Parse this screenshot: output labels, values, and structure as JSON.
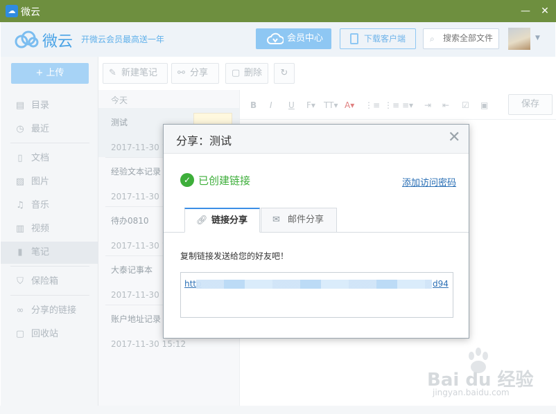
{
  "titlebar": {
    "title": "微云",
    "min_glyph": "—",
    "close_glyph": "✕"
  },
  "header": {
    "logo_text": "微云",
    "promo": "开微云会员最高送一年",
    "vip_button": "会员中心",
    "download_button": "下载客户端",
    "search_placeholder": "搜索全部文件"
  },
  "sidebar": {
    "upload_label": "+ 上传",
    "items": [
      {
        "label": "目录",
        "icon": "catalog-icon"
      },
      {
        "label": "最近",
        "icon": "clock-icon"
      },
      {
        "label": "文档",
        "icon": "document-icon"
      },
      {
        "label": "图片",
        "icon": "image-icon"
      },
      {
        "label": "音乐",
        "icon": "music-icon"
      },
      {
        "label": "视频",
        "icon": "video-icon"
      },
      {
        "label": "笔记",
        "icon": "note-icon"
      },
      {
        "label": "保险箱",
        "icon": "shield-icon"
      },
      {
        "label": "分享的链接",
        "icon": "link-icon"
      },
      {
        "label": "回收站",
        "icon": "trash-icon"
      }
    ]
  },
  "toolbar": {
    "new_note": "新建笔记",
    "share": "分享",
    "delete": "删除"
  },
  "notelist": {
    "today": "今天",
    "notes": [
      {
        "title": "测试",
        "date": "2017-11-30 1"
      },
      {
        "title": "经验文本记录",
        "date": "2017-11-30 1"
      },
      {
        "title": "待办0810",
        "date": "2017-11-30 1"
      },
      {
        "title": "大泰记事本",
        "date": "2017-11-30 1"
      },
      {
        "title": "账户地址记录",
        "date": "2017-11-30 15:12"
      }
    ]
  },
  "editor": {
    "format_buttons": [
      "B",
      "I",
      "U",
      "F▾",
      "TT▾",
      "A▾",
      "⋮≡",
      "⋮≡",
      "≡▾",
      "⇥",
      "⇤",
      "☑",
      "▣"
    ],
    "save": "保存"
  },
  "dialog": {
    "title": "分享：测试",
    "status": "已创建链接",
    "add_password": "添加访问密码",
    "tabs": [
      {
        "label": "链接分享"
      },
      {
        "label": "邮件分享"
      }
    ],
    "hint": "复制链接发送给您的好友吧！",
    "link_start": "http",
    "link_end": "d94"
  },
  "watermark": {
    "main": "Bai du 经验",
    "sub": "jingyan.baidu.com"
  },
  "colors": {
    "titlebar": "#6e8f3f",
    "accent": "#3a8ee6",
    "success": "#3dae3a",
    "link": "#2a6fb5"
  }
}
